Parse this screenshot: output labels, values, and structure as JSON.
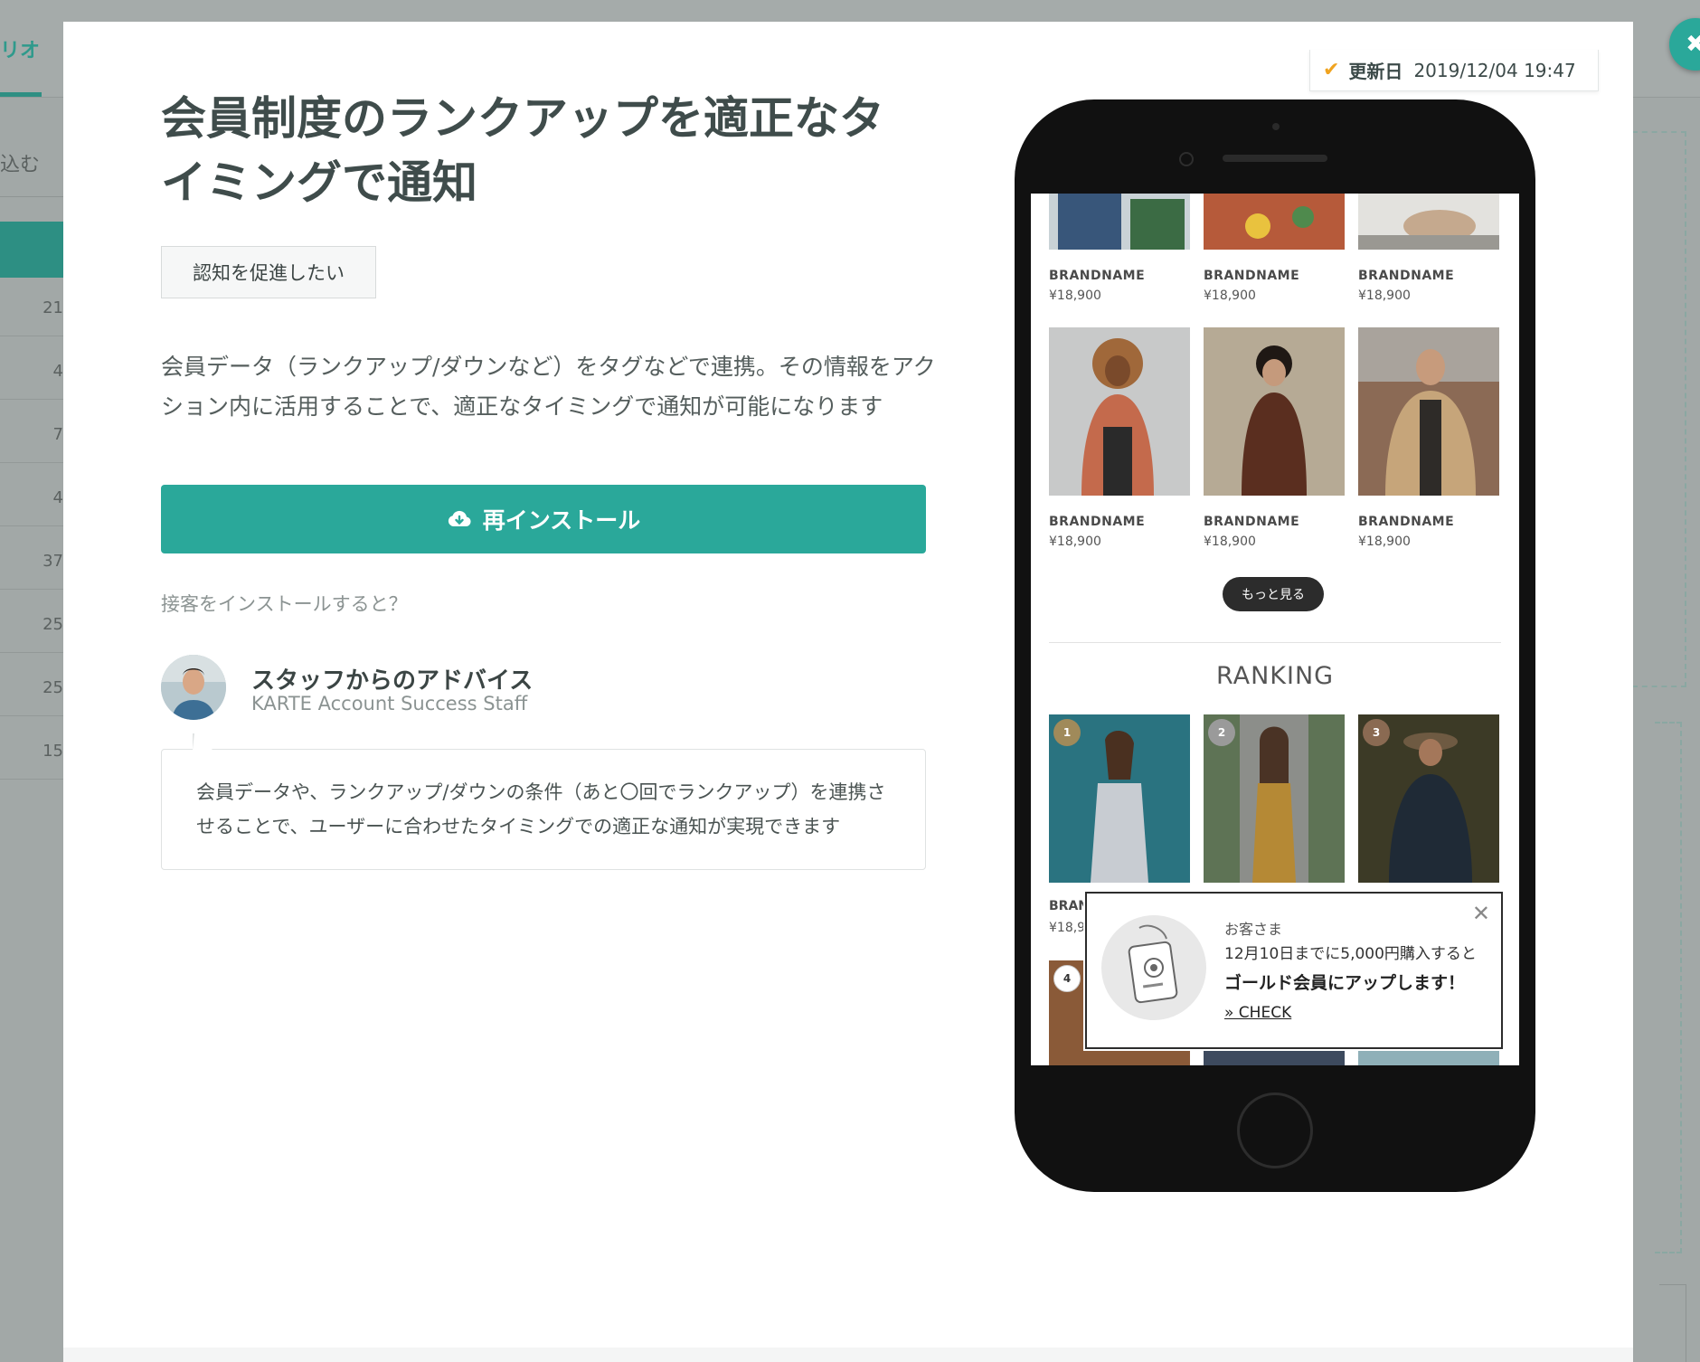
{
  "background": {
    "tab_label": "リオ",
    "search_label": "込む",
    "row_numbers": [
      "21",
      "4",
      "7",
      "4",
      "37",
      "25",
      "25",
      "15"
    ]
  },
  "modal": {
    "updated_label": "更新日",
    "updated_value": "2019/12/04  19:47",
    "title": "会員制度のランクアップを適正なタイミングで通知",
    "tag": "認知を促進したい",
    "description": "会員データ（ランクアップ/ダウンなど）をタグなどで連携。その情報をアクション内に活用することで、適正なタイミングで通知が可能になります",
    "install_button": "再インストール",
    "install_help_link": "接客をインストールすると？",
    "advice": {
      "name": "スタッフからのアドバイス",
      "role": "KARTE Account Success Staff",
      "text": "会員データや、ランクアップ/ダウンの条件（あと〇回でランクアップ）を連携させることで、ユーザーに合わせたタイミングでの適正な通知が実現できます"
    }
  },
  "preview": {
    "products_row1": [
      {
        "brand": "BRANDNAME",
        "price": "¥18,900"
      },
      {
        "brand": "BRANDNAME",
        "price": "¥18,900"
      },
      {
        "brand": "BRANDNAME",
        "price": "¥18,900"
      }
    ],
    "products_row2": [
      {
        "brand": "BRANDNAME",
        "price": "¥18,900"
      },
      {
        "brand": "BRANDNAME",
        "price": "¥18,900"
      },
      {
        "brand": "BRANDNAME",
        "price": "¥18,900"
      }
    ],
    "more_button": "もっと見る",
    "ranking_title": "RANKING",
    "rank_badges": [
      "1",
      "2",
      "3",
      "4"
    ],
    "partial_brand": "BRAN",
    "partial_price": "¥18,9",
    "popup": {
      "line1": "お客さま",
      "line2": "12月10日までに5,000円購入すると",
      "line3": "ゴールド会員にアップします！",
      "link": "» CHECK"
    }
  },
  "colors": {
    "accent": "#2aa89a",
    "check": "#f0a31f",
    "text_dark": "#3f4c4b"
  }
}
